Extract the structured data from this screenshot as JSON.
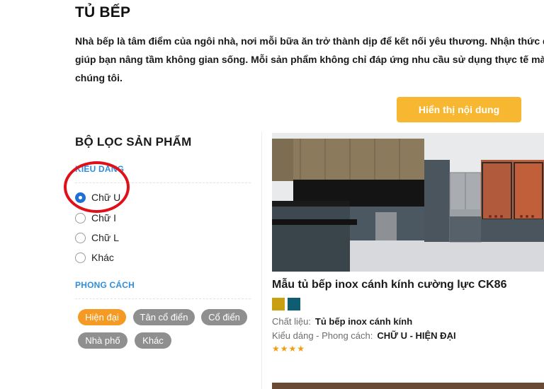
{
  "page": {
    "title": "TỦ BẾP",
    "intro_lines": [
      "Nhà bếp là tâm điểm của ngôi nhà, nơi mỗi bữa ăn trở thành dịp để kết nối yêu thương. Nhận thức được",
      "giúp bạn nâng tầm không gian sống. Mỗi sản phẩm không chỉ đáp ứng nhu cầu sử dụng thực tế mà c",
      "chúng tôi."
    ],
    "show_button": "Hiển thị nội dung"
  },
  "filter": {
    "title": "BỘ LỌC SẢN PHẨM",
    "shape_label": "KIỂU DÁNG",
    "shape_options": [
      "Chữ U",
      "Chữ I",
      "Chữ L",
      "Khác"
    ],
    "shape_selected": "Chữ U",
    "style_label": "PHONG CÁCH",
    "style_tags": [
      "Hiện đại",
      "Tân cổ điển",
      "Cổ điển",
      "Nhà phố",
      "Khác"
    ],
    "style_selected": "Hiện đại"
  },
  "product": {
    "name": "Mẫu tủ bếp inox cánh kính cường lực CK86",
    "swatches": [
      "#c9a013",
      "#0e5d73"
    ],
    "material_label": "Chất liệu:",
    "material_value": "Tủ bếp inox cánh kính",
    "style_label": "Kiểu dáng - Phong cách:",
    "style_value": "CHỮ U - HIỆN ĐẠI",
    "rating": 4
  },
  "colors": {
    "accent_blue": "#2e8fde",
    "button_yellow": "#f7b731",
    "tag_active": "#f59a23",
    "tag_default": "#8f8f8f",
    "annotation_red": "#e0101a"
  }
}
